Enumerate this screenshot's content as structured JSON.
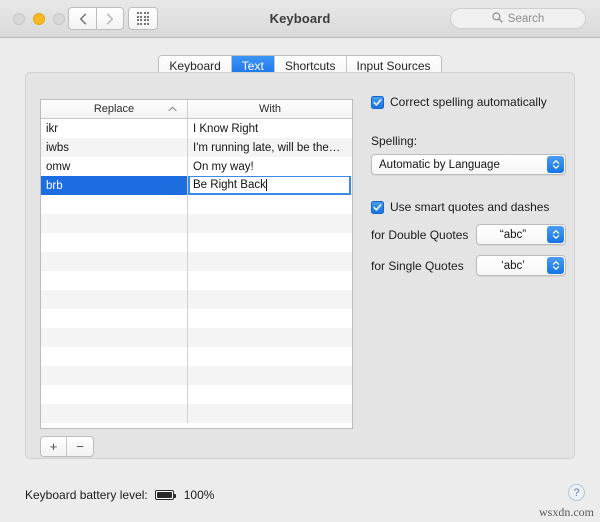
{
  "window": {
    "title": "Keyboard",
    "traffic_lights": [
      "close",
      "minimize",
      "zoom"
    ]
  },
  "toolbar": {
    "back_icon": "chevron-left-icon",
    "forward_icon": "chevron-right-icon",
    "grid_icon": "grid-icon",
    "search": {
      "icon": "search-icon",
      "placeholder": "Search",
      "value": ""
    }
  },
  "tabs": [
    {
      "label": "Keyboard",
      "active": false
    },
    {
      "label": "Text",
      "active": true
    },
    {
      "label": "Shortcuts",
      "active": false
    },
    {
      "label": "Input Sources",
      "active": false
    }
  ],
  "table": {
    "columns": [
      {
        "label": "Replace",
        "sort": "ascending",
        "sort_icon": "chevron-up-icon"
      },
      {
        "label": "With",
        "sort": "none"
      }
    ],
    "rows": [
      {
        "replace": "ikr",
        "with": "I Know Right",
        "selected": false
      },
      {
        "replace": "iwbs",
        "with": "I'm running late, will be the…",
        "selected": false
      },
      {
        "replace": "omw",
        "with": "On my way!",
        "selected": false
      },
      {
        "replace": "brb",
        "with": "Be Right Back",
        "selected": true,
        "editing": true
      }
    ],
    "empty_row_count": 12,
    "selection_color": "#1c6ee0",
    "editor_border_color": "#3b8ae8"
  },
  "table_buttons": {
    "add_label": "+",
    "remove_label": "−"
  },
  "options": {
    "correct_spelling": {
      "label": "Correct spelling automatically",
      "checked": true
    },
    "spelling": {
      "label": "Spelling:",
      "value": "Automatic by Language"
    },
    "smart_quotes": {
      "label": "Use smart quotes and dashes",
      "checked": true
    },
    "double_quotes": {
      "label": "for Double Quotes",
      "value": "“abc”"
    },
    "single_quotes": {
      "label": "for Single Quotes",
      "value": "‘abc’"
    }
  },
  "footer": {
    "battery_label": "Keyboard battery level:",
    "battery_icon": "battery-full-icon",
    "battery_percent": "100%",
    "help_label": "?",
    "watermark": "wsxdn.com"
  },
  "colors": {
    "accent": "#1c6ee0",
    "tab_active": "#2e86f0",
    "window_bg": "#ececec",
    "panel_bg": "#e4e4e4"
  }
}
